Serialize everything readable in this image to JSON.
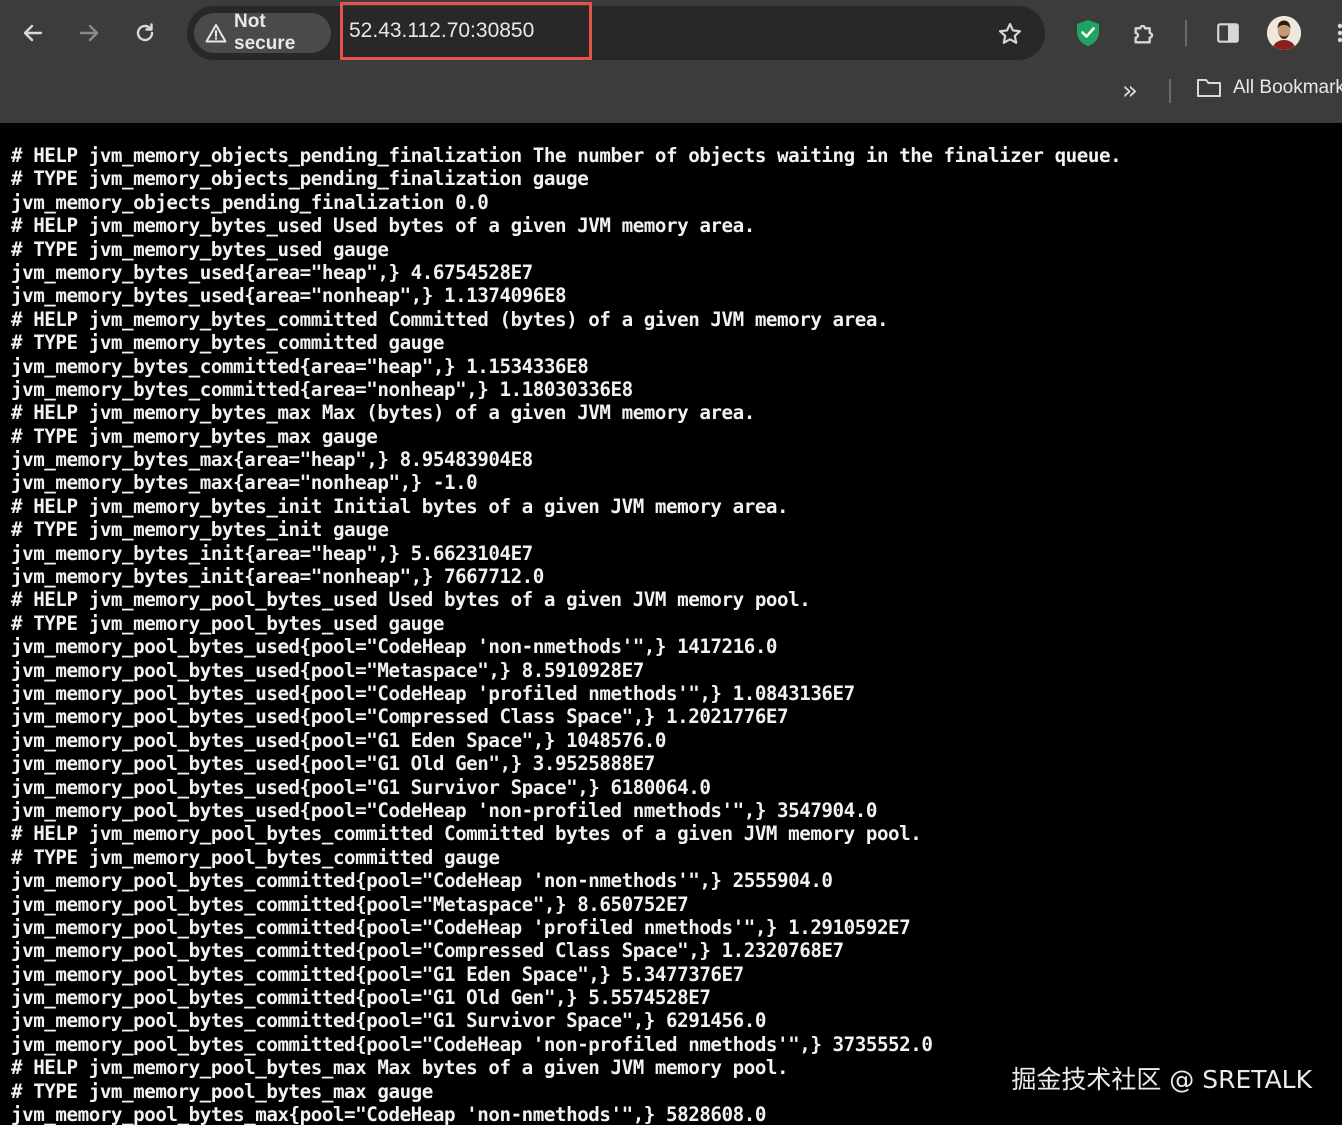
{
  "browser": {
    "security_label": "Not secure",
    "url": "52.43.112.70:30850",
    "bookmarks_label": "All Bookmark",
    "colors": {
      "frame": "#3c3c3c",
      "omnibox": "#282828",
      "highlight": "#e5534b",
      "shield": "#1fa463"
    }
  },
  "metrics": {
    "lines": [
      "# HELP jvm_memory_objects_pending_finalization The number of objects waiting in the finalizer queue.",
      "# TYPE jvm_memory_objects_pending_finalization gauge",
      "jvm_memory_objects_pending_finalization 0.0",
      "# HELP jvm_memory_bytes_used Used bytes of a given JVM memory area.",
      "# TYPE jvm_memory_bytes_used gauge",
      "jvm_memory_bytes_used{area=\"heap\",} 4.6754528E7",
      "jvm_memory_bytes_used{area=\"nonheap\",} 1.1374096E8",
      "# HELP jvm_memory_bytes_committed Committed (bytes) of a given JVM memory area.",
      "# TYPE jvm_memory_bytes_committed gauge",
      "jvm_memory_bytes_committed{area=\"heap\",} 1.1534336E8",
      "jvm_memory_bytes_committed{area=\"nonheap\",} 1.18030336E8",
      "# HELP jvm_memory_bytes_max Max (bytes) of a given JVM memory area.",
      "# TYPE jvm_memory_bytes_max gauge",
      "jvm_memory_bytes_max{area=\"heap\",} 8.95483904E8",
      "jvm_memory_bytes_max{area=\"nonheap\",} -1.0",
      "# HELP jvm_memory_bytes_init Initial bytes of a given JVM memory area.",
      "# TYPE jvm_memory_bytes_init gauge",
      "jvm_memory_bytes_init{area=\"heap\",} 5.6623104E7",
      "jvm_memory_bytes_init{area=\"nonheap\",} 7667712.0",
      "# HELP jvm_memory_pool_bytes_used Used bytes of a given JVM memory pool.",
      "# TYPE jvm_memory_pool_bytes_used gauge",
      "jvm_memory_pool_bytes_used{pool=\"CodeHeap 'non-nmethods'\",} 1417216.0",
      "jvm_memory_pool_bytes_used{pool=\"Metaspace\",} 8.5910928E7",
      "jvm_memory_pool_bytes_used{pool=\"CodeHeap 'profiled nmethods'\",} 1.0843136E7",
      "jvm_memory_pool_bytes_used{pool=\"Compressed Class Space\",} 1.2021776E7",
      "jvm_memory_pool_bytes_used{pool=\"G1 Eden Space\",} 1048576.0",
      "jvm_memory_pool_bytes_used{pool=\"G1 Old Gen\",} 3.9525888E7",
      "jvm_memory_pool_bytes_used{pool=\"G1 Survivor Space\",} 6180064.0",
      "jvm_memory_pool_bytes_used{pool=\"CodeHeap 'non-profiled nmethods'\",} 3547904.0",
      "# HELP jvm_memory_pool_bytes_committed Committed bytes of a given JVM memory pool.",
      "# TYPE jvm_memory_pool_bytes_committed gauge",
      "jvm_memory_pool_bytes_committed{pool=\"CodeHeap 'non-nmethods'\",} 2555904.0",
      "jvm_memory_pool_bytes_committed{pool=\"Metaspace\",} 8.650752E7",
      "jvm_memory_pool_bytes_committed{pool=\"CodeHeap 'profiled nmethods'\",} 1.2910592E7",
      "jvm_memory_pool_bytes_committed{pool=\"Compressed Class Space\",} 1.2320768E7",
      "jvm_memory_pool_bytes_committed{pool=\"G1 Eden Space\",} 5.3477376E7",
      "jvm_memory_pool_bytes_committed{pool=\"G1 Old Gen\",} 5.5574528E7",
      "jvm_memory_pool_bytes_committed{pool=\"G1 Survivor Space\",} 6291456.0",
      "jvm_memory_pool_bytes_committed{pool=\"CodeHeap 'non-profiled nmethods'\",} 3735552.0",
      "# HELP jvm_memory_pool_bytes_max Max bytes of a given JVM memory pool.",
      "# TYPE jvm_memory_pool_bytes_max gauge",
      "jvm_memory_pool_bytes_max{pool=\"CodeHeap 'non-nmethods'\",} 5828608.0"
    ]
  },
  "watermark": "掘金技术社区 @ SRETALK"
}
